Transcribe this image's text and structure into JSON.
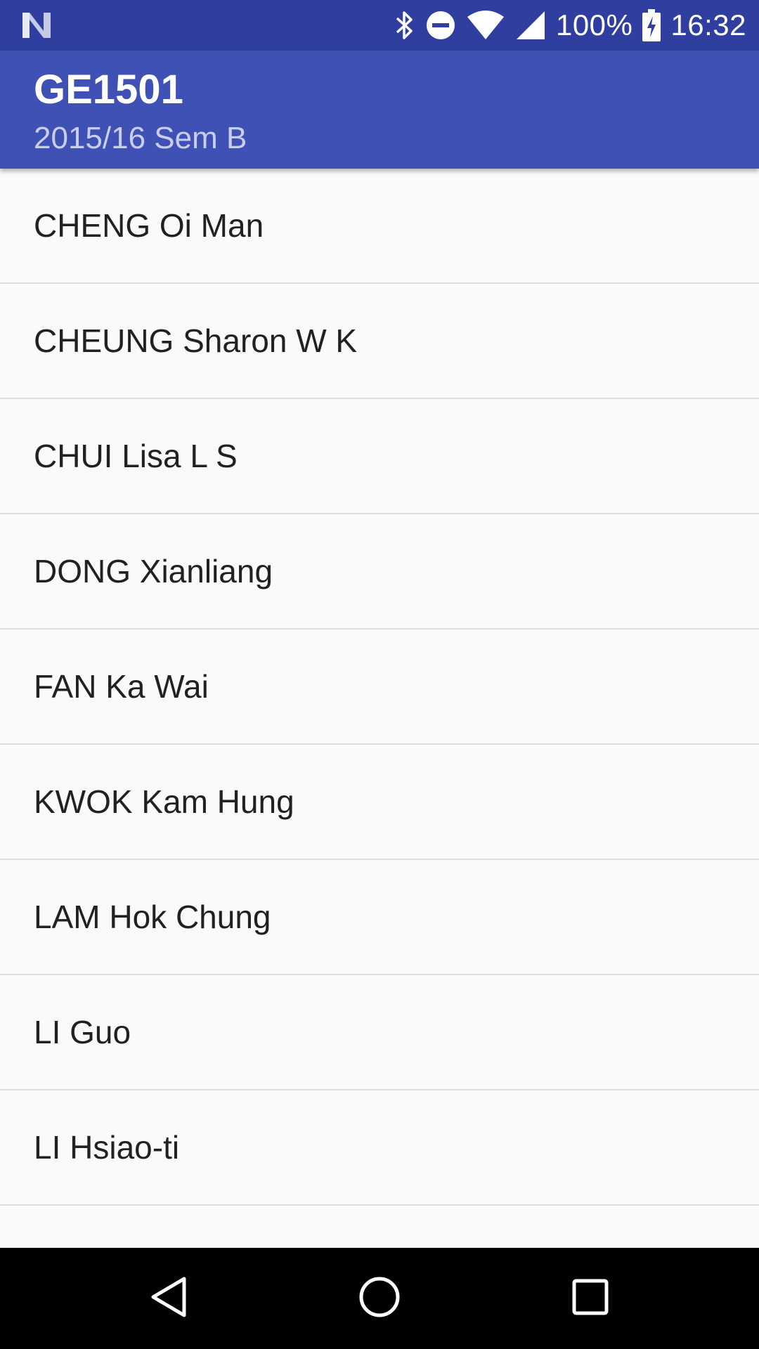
{
  "status_bar": {
    "battery_percent": "100%",
    "time": "16:32",
    "icons": [
      "notification-n-icon",
      "bluetooth-icon",
      "do-not-disturb-icon",
      "wifi-icon",
      "cell-signal-icon",
      "battery-charging-icon"
    ]
  },
  "app_bar": {
    "title": "GE1501",
    "subtitle": "2015/16 Sem B",
    "color": "#3f51b5"
  },
  "list": {
    "items": [
      {
        "label": "CHENG Oi Man"
      },
      {
        "label": "CHEUNG Sharon W K"
      },
      {
        "label": "CHUI Lisa L S"
      },
      {
        "label": "DONG Xianliang"
      },
      {
        "label": "FAN Ka Wai"
      },
      {
        "label": "KWOK Kam Hung"
      },
      {
        "label": "LAM Hok Chung"
      },
      {
        "label": "LI Guo"
      },
      {
        "label": "LI Hsiao-ti"
      },
      {
        "label": ""
      }
    ]
  },
  "nav_bar": {
    "buttons": [
      "back-icon",
      "home-icon",
      "recents-icon"
    ]
  }
}
